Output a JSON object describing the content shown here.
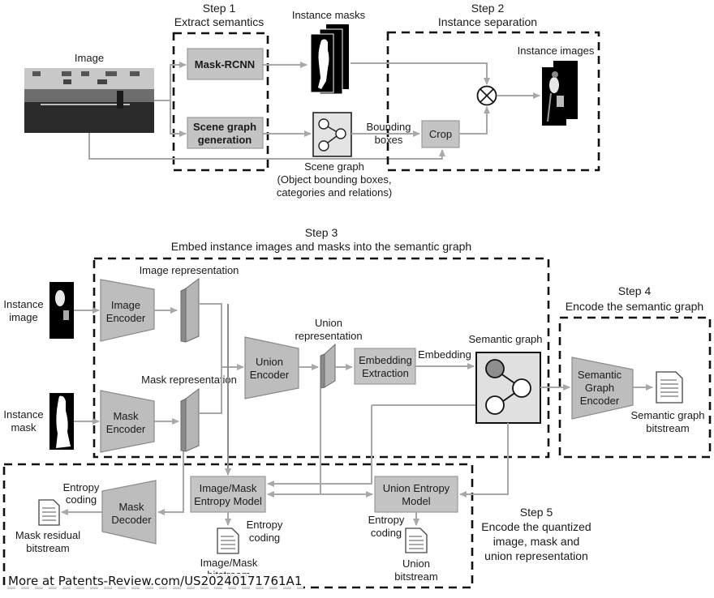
{
  "step1": {
    "title": "Step 1",
    "subtitle": "Extract semantics",
    "mask_rcnn": "Mask-RCNN",
    "scene_graph_gen": [
      "Scene graph",
      "generation"
    ]
  },
  "step2": {
    "title": "Step 2",
    "subtitle": "Instance separation",
    "crop": "Crop",
    "instance_images": "Instance images"
  },
  "step3": {
    "title": "Step 3",
    "subtitle": "Embed instance images and masks into the semantic graph"
  },
  "step4": {
    "title": "Step 4",
    "subtitle": "Encode the semantic graph"
  },
  "step5": {
    "title": "Step 5",
    "subtitle": [
      "Encode the quantized",
      "image, mask and",
      "union representation"
    ]
  },
  "labels": {
    "image": "Image",
    "instance_masks": "Instance masks",
    "bounding_boxes": [
      "Bounding",
      "boxes"
    ],
    "scene_graph": [
      "Scene graph",
      "(Object bounding boxes,",
      "categories and relations)"
    ],
    "instance_image": [
      "Instance",
      "image"
    ],
    "instance_mask": [
      "Instance",
      "mask"
    ],
    "image_encoder": [
      "Image",
      "Encoder"
    ],
    "mask_encoder": [
      "Mask",
      "Encoder"
    ],
    "image_representation": "Image representation",
    "mask_representation": "Mask representation",
    "union_encoder": [
      "Union",
      "Encoder"
    ],
    "union_representation": [
      "Union",
      "representation"
    ],
    "embedding_extraction": [
      "Embedding",
      "Extraction"
    ],
    "embedding": "Embedding",
    "semantic_graph": "Semantic graph",
    "semantic_graph_encoder": [
      "Semantic",
      "Graph",
      "Encoder"
    ],
    "semantic_graph_bitstream": [
      "Semantic graph",
      "bitstream"
    ],
    "image_mask_entropy_model": [
      "Image/Mask",
      "Entropy Model"
    ],
    "union_entropy_model": [
      "Union Entropy",
      "Model"
    ],
    "mask_decoder": [
      "Mask",
      "Decoder"
    ],
    "entropy_coding": [
      "Entropy",
      "coding"
    ],
    "mask_residual_bitstream": [
      "Mask residual",
      "bitstream"
    ],
    "image_mask_bitstream": [
      "Image/Mask",
      "bitstream"
    ],
    "union_bitstream": [
      "Union",
      "bitstream"
    ]
  },
  "watermark": "More at Patents-Review.com/US20240171761A1"
}
